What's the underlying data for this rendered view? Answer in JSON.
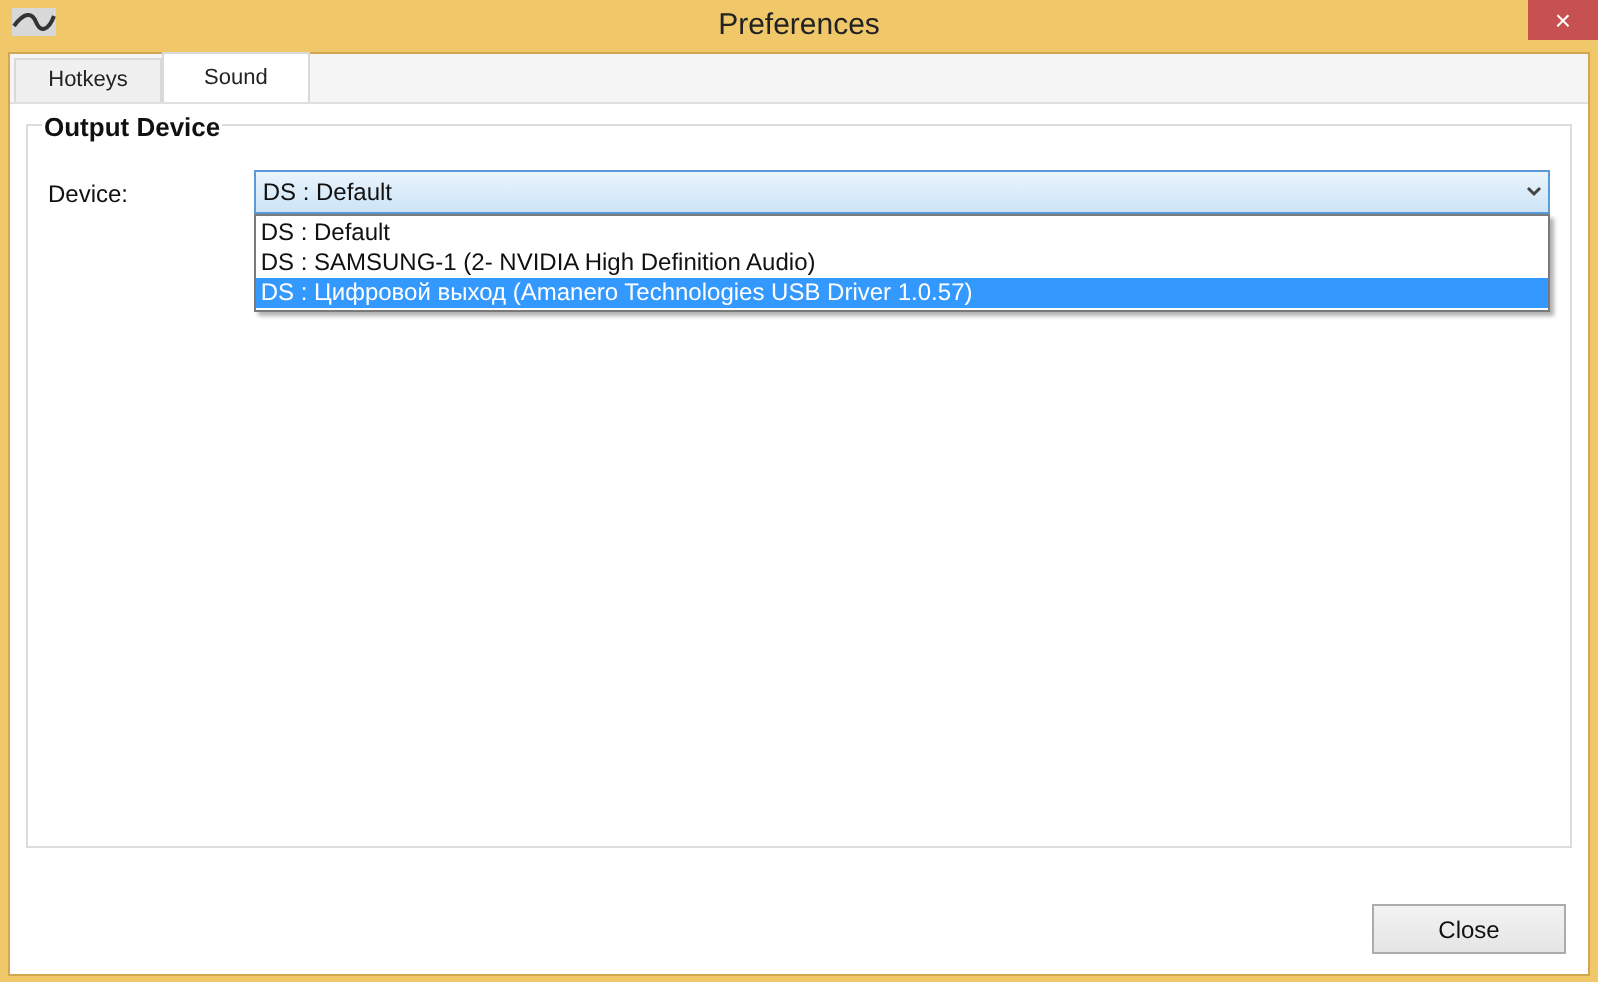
{
  "window": {
    "title": "Preferences",
    "close": "×"
  },
  "tabs": [
    {
      "label": "Hotkeys",
      "selected": false
    },
    {
      "label": "Sound",
      "selected": true
    }
  ],
  "group": {
    "title": "Output Device"
  },
  "device": {
    "label": "Device:",
    "value": "DS : Default",
    "expanded": true,
    "options": [
      {
        "label": "DS : Default",
        "highlighted": false
      },
      {
        "label": "DS : SAMSUNG-1 (2- NVIDIA High Definition Audio)",
        "highlighted": false
      },
      {
        "label": "DS : Цифровой выход (Amanero Technologies USB Driver 1.0.57)",
        "highlighted": true
      }
    ]
  },
  "buttons": [
    "Close"
  ]
}
